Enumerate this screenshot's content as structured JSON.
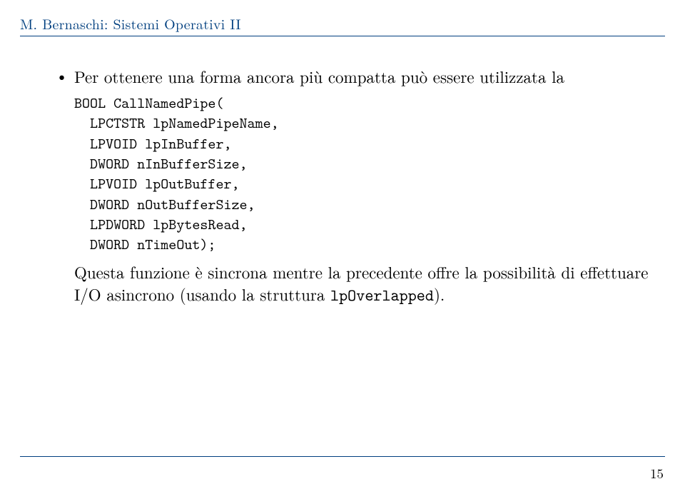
{
  "header": {
    "text": "M. Bernaschi: Sistemi Operativi II"
  },
  "bullet": {
    "intro_before": "Per ottenere una forma ancora pi",
    "intro_accent": "ù",
    "intro_mid": " compatta pu",
    "intro_accent2": "ò",
    "intro_after": " essere utilizzata la",
    "code": {
      "l0": "BOOL CallNamedPipe(",
      "l1": "  LPCTSTR lpNamedPipeName,",
      "l2": "  LPVOID lpInBuffer,",
      "l3": "  DWORD nInBufferSize,",
      "l4": "  LPVOID lpOutBuffer,",
      "l5": "  DWORD nOutBufferSize,",
      "l6": "  LPDWORD lpBytesRead,",
      "l7": "  DWORD nTimeOut);"
    },
    "para2_a": "Questa funzione ",
    "para2_accent": "è",
    "para2_b": " sincrona mentre la precedente offre la possibilit",
    "para2_accent2": "à",
    "para2_c": " di effettuare I/O asincrono (usando la struttura ",
    "para2_code": "lpOverlapped",
    "para2_d": ")."
  },
  "page_number": "15"
}
